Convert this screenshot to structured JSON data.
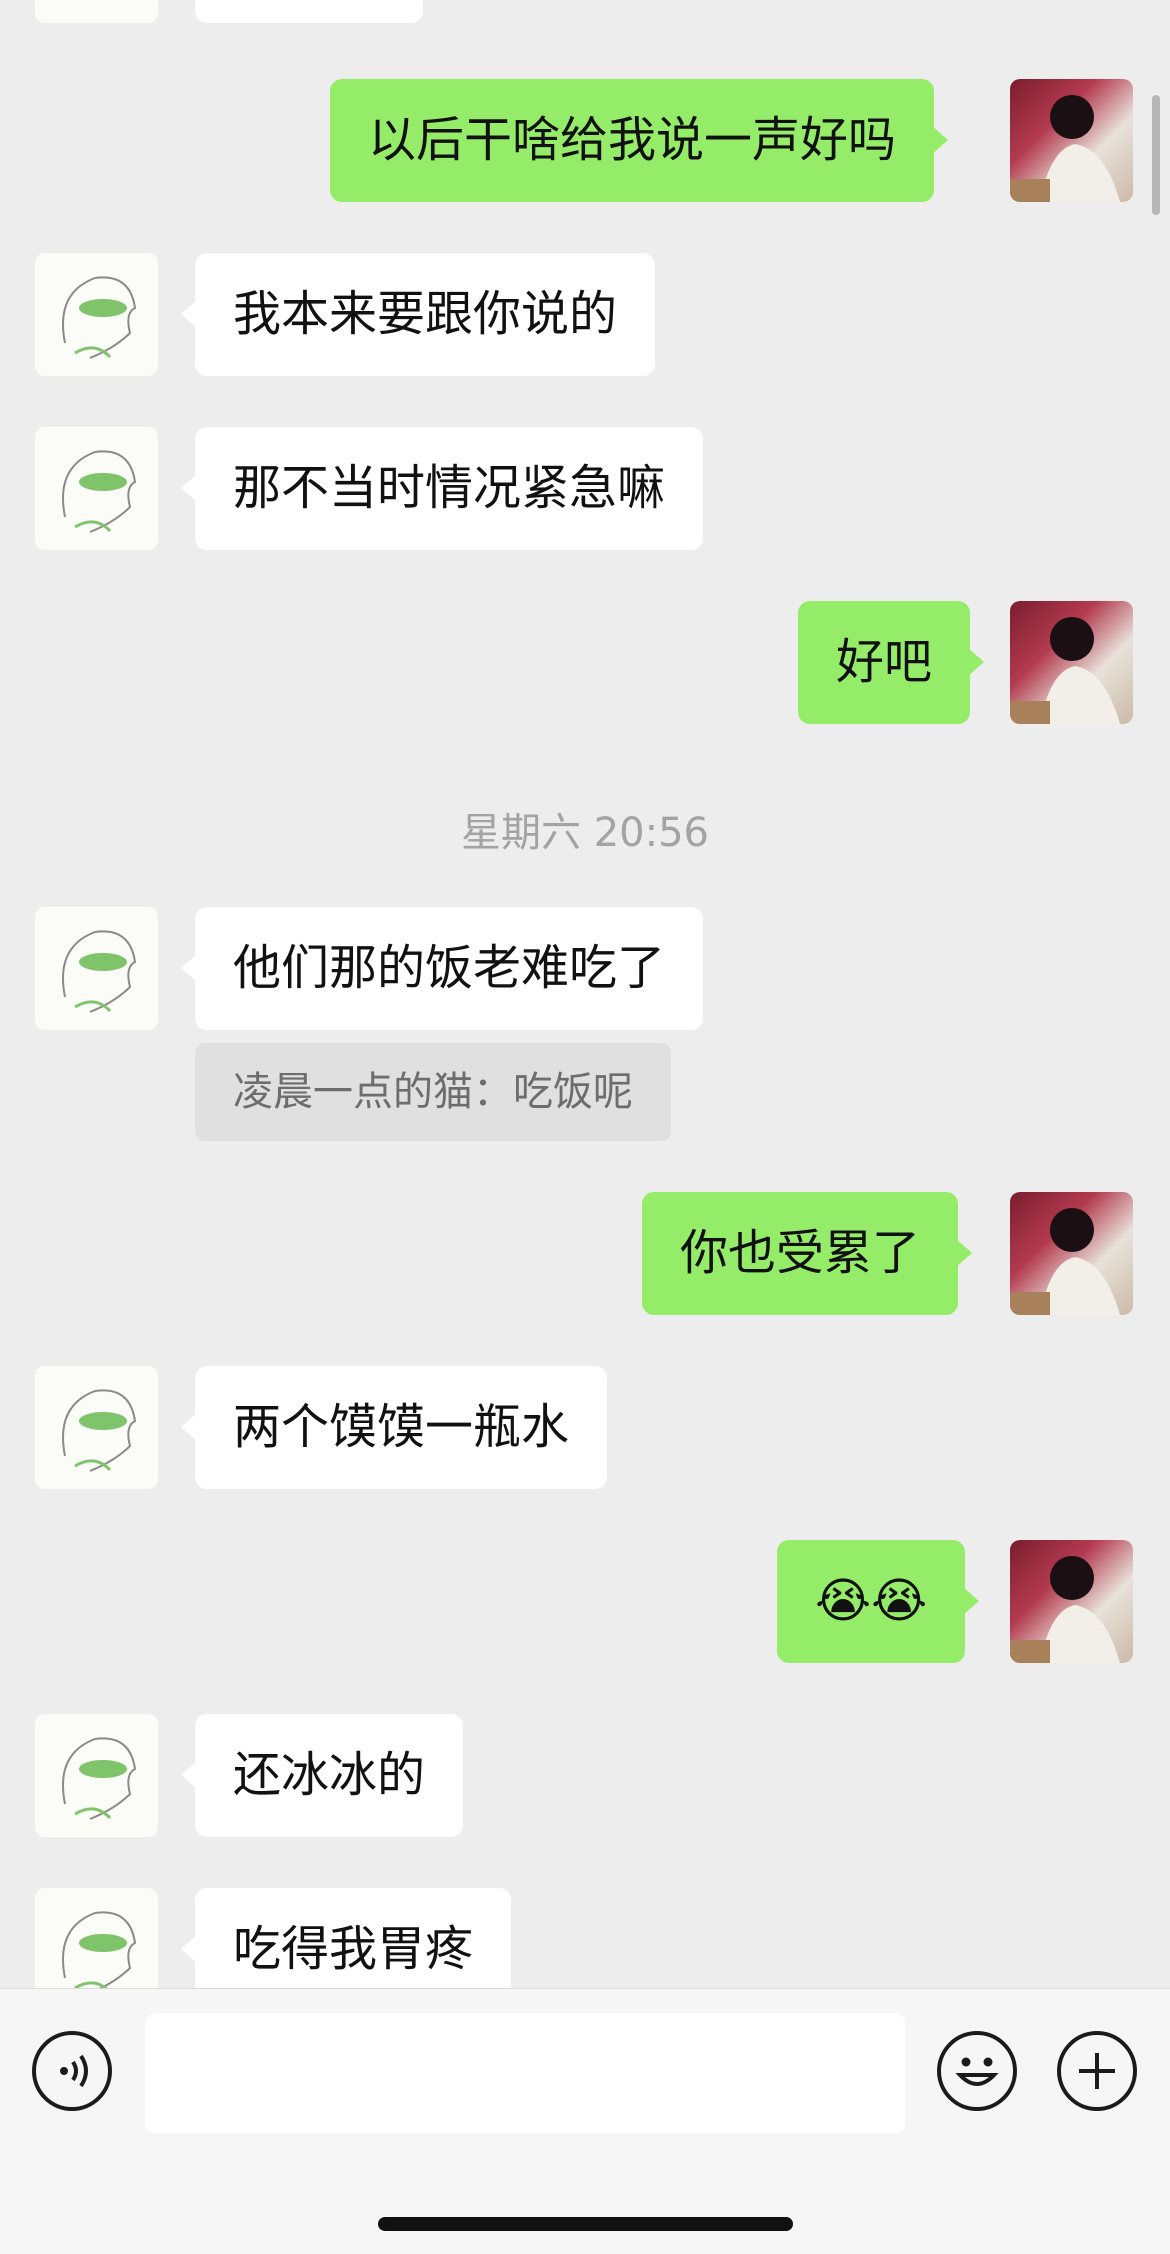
{
  "messages": [
    {
      "id": "m0",
      "text": "以后干啥给我说一声好吗"
    },
    {
      "id": "m1",
      "text": "我本来要跟你说的"
    },
    {
      "id": "m2",
      "text": "那不当时情况紧急嘛"
    },
    {
      "id": "m3",
      "text": "好吧"
    },
    {
      "id": "m4",
      "text": "他们那的饭老难吃了"
    },
    {
      "id": "m5",
      "text": "你也受累了"
    },
    {
      "id": "m6",
      "text": "两个馍馍一瓶水"
    },
    {
      "id": "m7",
      "text": "😭😭"
    },
    {
      "id": "m8",
      "text": "还冰冰的"
    },
    {
      "id": "m9",
      "text": "吃得我胃疼"
    }
  ],
  "timestamp": "星期六 20:56",
  "quote": {
    "text": "凌晨一点的猫：吃饭呢"
  },
  "input_bar": {
    "voice_icon": "voice-icon",
    "emoji_icon": "emoji-icon",
    "plus_icon": "plus-icon",
    "text_value": ""
  },
  "colors": {
    "background": "#ededed",
    "outgoing_bubble": "#95ec69",
    "incoming_bubble": "#ffffff"
  }
}
